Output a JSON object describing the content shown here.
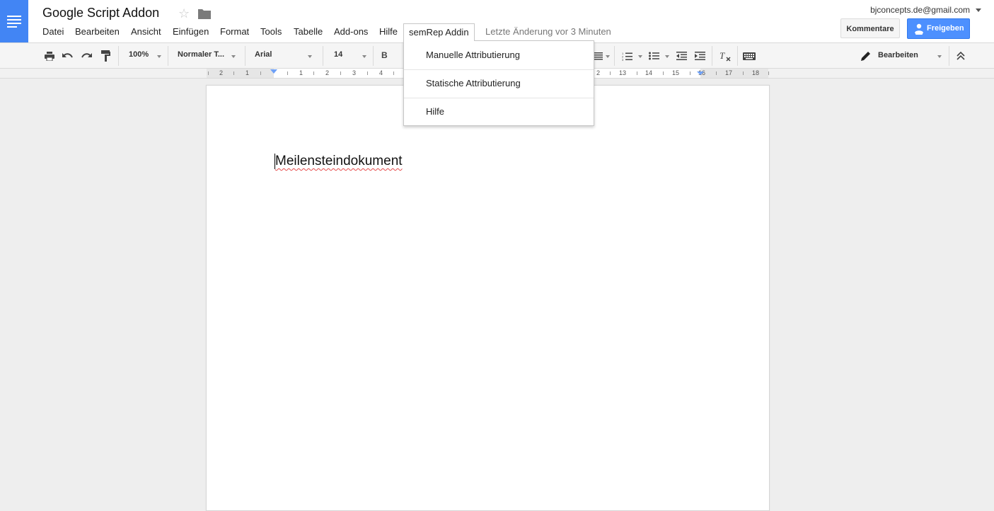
{
  "app": {
    "doc_title": "Google Script Addon",
    "last_edit": "Letzte Änderung vor 3 Minuten",
    "account_email": "bjconcepts.de@gmail.com",
    "comments_label": "Kommentare",
    "share_label": "Freigeben"
  },
  "menu": {
    "items": [
      "Datei",
      "Bearbeiten",
      "Ansicht",
      "Einfügen",
      "Format",
      "Tools",
      "Tabelle",
      "Add-ons",
      "Hilfe",
      "semRep Addin"
    ],
    "open_menu": "semRep Addin"
  },
  "dropdown": {
    "items": [
      "Manuelle Attributierung",
      "Statische Attributierung",
      "Hilfe"
    ]
  },
  "toolbar": {
    "zoom": "100%",
    "style": "Normaler T...",
    "font": "Arial",
    "font_size": "14",
    "bold_label": "B",
    "mode_label": "Bearbeiten",
    "icons": [
      "print-icon",
      "undo-icon",
      "redo-icon",
      "paint-format-icon",
      "bold-icon",
      "align-justify-icon",
      "numbered-list-icon",
      "bulleted-list-icon",
      "decrease-indent-icon",
      "increase-indent-icon",
      "clear-formatting-icon",
      "input-tools-icon",
      "pencil-icon",
      "collapse-icon"
    ]
  },
  "ruler": {
    "labels": [
      "2",
      "1",
      "1",
      "2",
      "3",
      "4",
      "2",
      "13",
      "14",
      "15",
      "16",
      "17",
      "18"
    ]
  },
  "document": {
    "text": "Meilensteindokument"
  },
  "colors": {
    "brand_blue": "#4285f4",
    "share_button": "#4d90fe",
    "spellcheck_underline": "#e54b4b"
  }
}
